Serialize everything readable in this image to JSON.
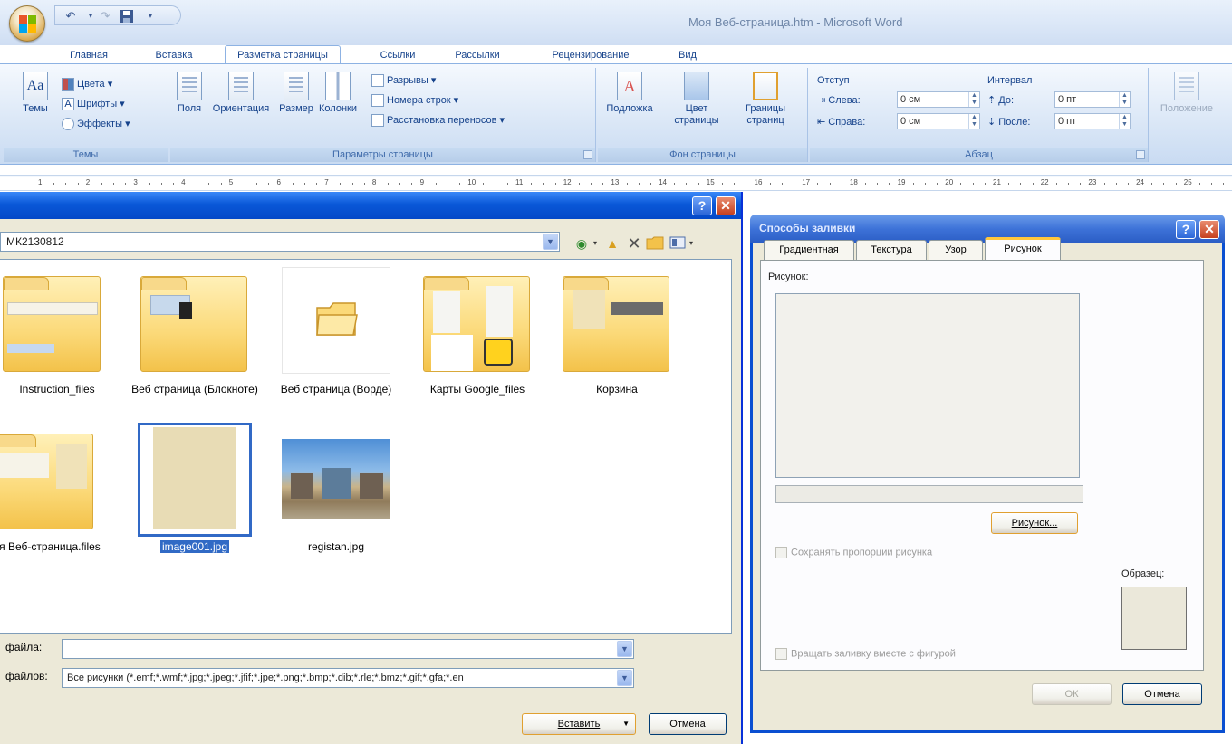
{
  "window": {
    "title": "Моя Веб-страница.htm - Microsoft Word"
  },
  "tabs": [
    "Главная",
    "Вставка",
    "Разметка страницы",
    "Ссылки",
    "Рассылки",
    "Рецензирование",
    "Вид"
  ],
  "active_tab": "Разметка страницы",
  "ribbon": {
    "themes": {
      "label": "Темы",
      "button": "Темы",
      "colors": "Цвета",
      "fonts": "Шрифты",
      "effects": "Эффекты"
    },
    "page_setup": {
      "label": "Параметры страницы",
      "margins": "Поля",
      "orientation": "Ориентация",
      "size": "Размер",
      "columns": "Колонки",
      "breaks": "Разрывы",
      "line_numbers": "Номера строк",
      "hyphenation": "Расстановка переносов"
    },
    "page_background": {
      "label": "Фон страницы",
      "watermark": "Подложка",
      "page_color": "Цвет страницы",
      "page_borders": "Границы страниц"
    },
    "paragraph": {
      "label": "Абзац",
      "indent_title": "Отступ",
      "left_label": "Слева:",
      "left_value": "0 см",
      "right_label": "Справа:",
      "right_value": "0 см",
      "spacing_title": "Интервал",
      "before_label": "До:",
      "before_value": "0 пт",
      "after_label": "После:",
      "after_value": "0 пт"
    },
    "arrange": {
      "position": "Положение"
    }
  },
  "ruler": {
    "ticks": [
      "1",
      "2",
      "3",
      "4",
      "5",
      "6",
      "7",
      "8",
      "9",
      "10",
      "11",
      "12",
      "13",
      "14",
      "15",
      "16",
      "17",
      "18",
      "19",
      "20",
      "21",
      "22",
      "23",
      "24",
      "25"
    ]
  },
  "insert_dialog": {
    "path": "МК2130812",
    "files": [
      {
        "name": "Instruction_files",
        "type": "folder"
      },
      {
        "name": "Веб страница (Блокноте)",
        "type": "folder"
      },
      {
        "name": "Веб страница (Ворде)",
        "type": "folder-empty"
      },
      {
        "name": "Карты Google_files",
        "type": "folder"
      },
      {
        "name": "Корзина",
        "type": "folder"
      },
      {
        "name": "я Веб-страница.files",
        "type": "folder"
      },
      {
        "name": "image001.jpg",
        "type": "image",
        "selected": true
      },
      {
        "name": "registan.jpg",
        "type": "photo"
      }
    ],
    "filename_label": "файла:",
    "filetype_label": "файлов:",
    "filename_value": "",
    "filetype_value": "Все рисунки (*.emf;*.wmf;*.jpg;*.jpeg;*.jfif;*.jpe;*.png;*.bmp;*.dib;*.rle;*.bmz;*.gif;*.gfa;*.en",
    "insert_button": "Вставить",
    "cancel_button": "Отмена"
  },
  "fill_dialog": {
    "title": "Способы заливки",
    "tabs": [
      "Градиентная",
      "Текстура",
      "Узор",
      "Рисунок"
    ],
    "active_tab": "Рисунок",
    "picture_label": "Рисунок:",
    "picture_button": "Рисунок...",
    "lock_aspect": "Сохранять пропорции рисунка",
    "sample_label": "Образец:",
    "rotate_with_shape": "Вращать заливку вместе с фигурой",
    "ok_button": "ОК",
    "cancel_button": "Отмена"
  },
  "colors": {
    "title_bar_blue": "#0a58d8",
    "selection": "#316ac5",
    "folder_yellow": "#fbd978",
    "ribbon_text": "#15428b"
  }
}
